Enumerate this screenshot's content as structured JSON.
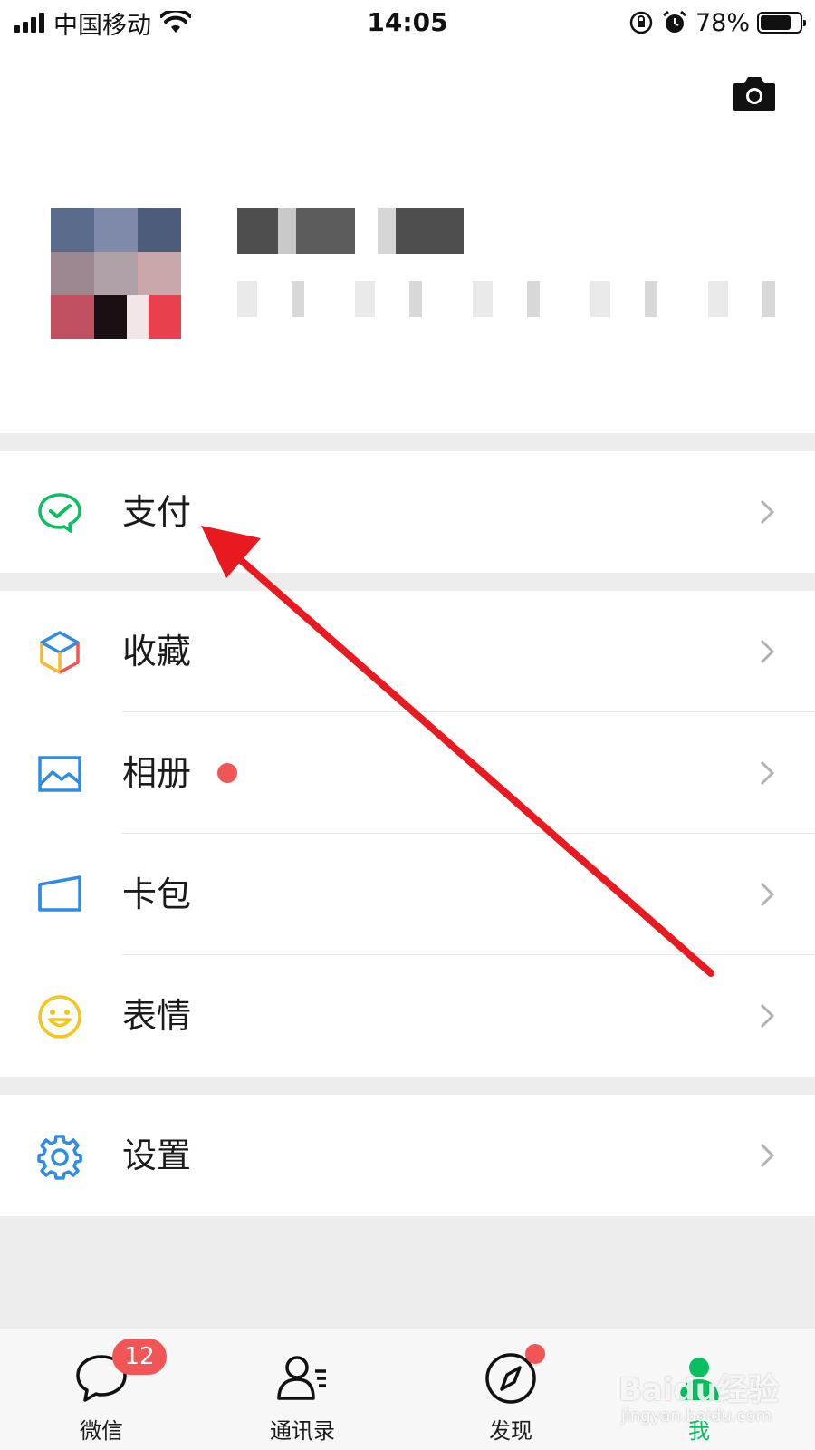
{
  "status_bar": {
    "carrier": "中国移动",
    "time": "14:05",
    "battery": "78%",
    "battery_level": 0.78
  },
  "profile": {
    "camera_icon": "camera-icon"
  },
  "menu": {
    "group1": [
      {
        "label": "支付",
        "icon": "wechat-pay-icon"
      }
    ],
    "group2": [
      {
        "label": "收藏",
        "icon": "favorites-cube-icon"
      },
      {
        "label": "相册",
        "icon": "album-picture-icon",
        "has_dot": true
      },
      {
        "label": "卡包",
        "icon": "card-wallet-icon"
      },
      {
        "label": "表情",
        "icon": "smiley-icon"
      }
    ],
    "group3": [
      {
        "label": "设置",
        "icon": "gear-icon"
      }
    ]
  },
  "tabbar": {
    "tabs": [
      {
        "label": "微信",
        "icon": "chat-bubble-icon",
        "badge": "12"
      },
      {
        "label": "通讯录",
        "icon": "contacts-icon"
      },
      {
        "label": "发现",
        "icon": "compass-icon",
        "has_dot": true
      },
      {
        "label": "我",
        "icon": "me-icon",
        "active": true
      }
    ]
  },
  "colors": {
    "accent_green": "#07c160",
    "badge_red": "#f25555",
    "annotation_red": "#e8191f",
    "background": "#ededed"
  },
  "watermark": {
    "text": "Baidu经验",
    "sub": "jingyan.baidu.com"
  }
}
